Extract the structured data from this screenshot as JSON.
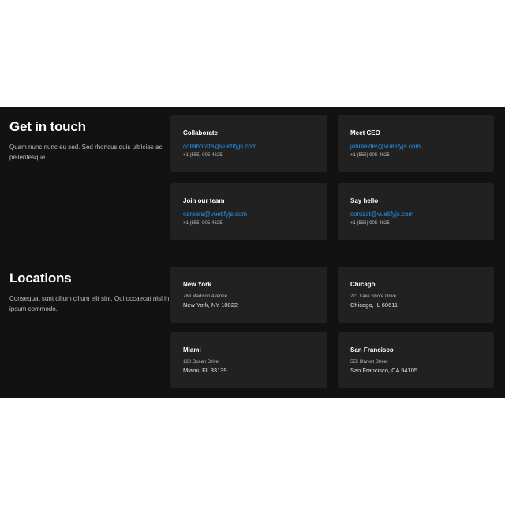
{
  "contact": {
    "heading": "Get in touch",
    "description": "Quam nunc nunc eu sed. Sed rhoncus quis ultricies ac pellentesque.",
    "cards": [
      {
        "title": "Collaborate",
        "email": "collaborate@vuetifyjs.com",
        "phone": "+1 (555) 905-4625"
      },
      {
        "title": "Meet CEO",
        "email": "johnleider@vuetifyjs.com",
        "phone": "+1 (555) 905-4625"
      },
      {
        "title": "Join our team",
        "email": "careers@vuetifyjs.com",
        "phone": "+1 (555) 905-4625"
      },
      {
        "title": "Say hello",
        "email": "contact@vuetifyjs.com",
        "phone": "+1 (555) 905-4625"
      }
    ]
  },
  "locations": {
    "heading": "Locations",
    "description": "Consequat sunt cillum cillum elit sint. Qui occaecat nisi in ipsum commodo.",
    "cards": [
      {
        "title": "New York",
        "street": "789 Madison Avenue",
        "city": "New York, NY 10022"
      },
      {
        "title": "Chicago",
        "street": "221 Lake Shore Drive",
        "city": "Chicago, IL 60611"
      },
      {
        "title": "Miami",
        "street": "123 Ocean Drive",
        "city": "Miami, FL 33139"
      },
      {
        "title": "San Francisco",
        "street": "555 Market Street",
        "city": "San Francisco, CA 94105"
      }
    ]
  },
  "colors": {
    "band_background": "#121212",
    "card_background": "#212121",
    "link": "#2196f3"
  }
}
